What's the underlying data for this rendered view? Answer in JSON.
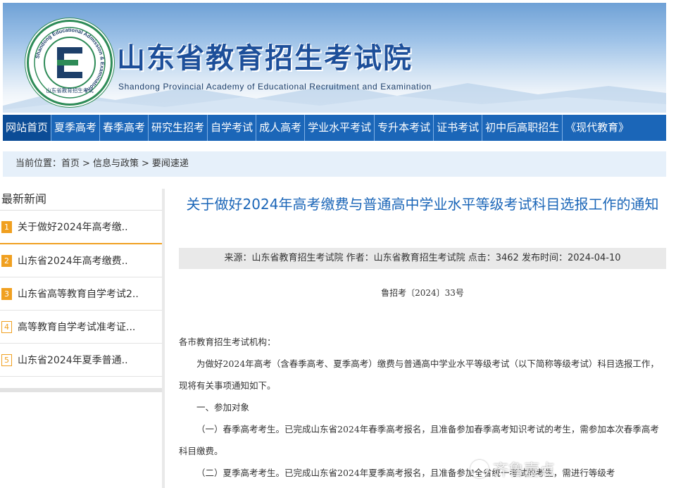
{
  "header": {
    "title": "山东省教育招生考试院",
    "subtitle": "Shandong Provincial Academy of Educational Recruitment and Examination",
    "logo_ring_text": "Shandong Educational Admission & Examinations",
    "logo_bottom_text": "山东省教育招生考试"
  },
  "nav": {
    "items": [
      "网站首页",
      "夏季高考",
      "春季高考",
      "研究生招考",
      "自学考试",
      "成人高考",
      "学业水平考试",
      "专升本考试",
      "证书考试",
      "初中后高职招生",
      "《现代教育》"
    ]
  },
  "breadcrumb": {
    "label": "当前位置：",
    "items": [
      "首页",
      "信息与政策",
      "要闻速递"
    ],
    "separator": ">"
  },
  "sidebar": {
    "title": "最新新闻",
    "items": [
      {
        "num": "1",
        "text": "关于做好2024年高考缴.."
      },
      {
        "num": "2",
        "text": "山东省2024年高考缴费.."
      },
      {
        "num": "3",
        "text": "山东省高等教育自学考试2.."
      },
      {
        "num": "4",
        "text": "高等教育自学考试准考证..."
      },
      {
        "num": "5",
        "text": "山东省2024年夏季普通.."
      }
    ]
  },
  "article": {
    "title": "关于做好2024年高考缴费与普通高中学业水平等级考试科目选报工作的通知",
    "meta": "来源：山东省教育招生考试院 作者：山东省教育招生考试院 点击：3462 发布时间：2024-04-10",
    "doc_number": "鲁招考〔2024〕33号",
    "paragraphs": [
      "各市教育招生考试机构：",
      "为做好2024年高考（含春季高考、夏季高考）缴费与普通高中学业水平等级考试（以下简称等级考试）科目选报工作，现将有关事项通知如下。",
      "一、参加对象",
      "（一）春季高考考生。已完成山东省2024年春季高考报名，且准备参加春季高考知识考试的考生，需参加本次春季高考科目缴费。",
      "（二）夏季高考考生。已完成山东省2024年夏季高考报名，且准备参加全省统一考试的考生，需进行等级考"
    ]
  },
  "watermark": {
    "text": "齐鲁壹点"
  },
  "colors": {
    "nav_bg": "#1b66b8",
    "title_blue": "#1b66b8",
    "accent_orange": "#f0a020",
    "crumb_bg": "#e6f0fa"
  }
}
